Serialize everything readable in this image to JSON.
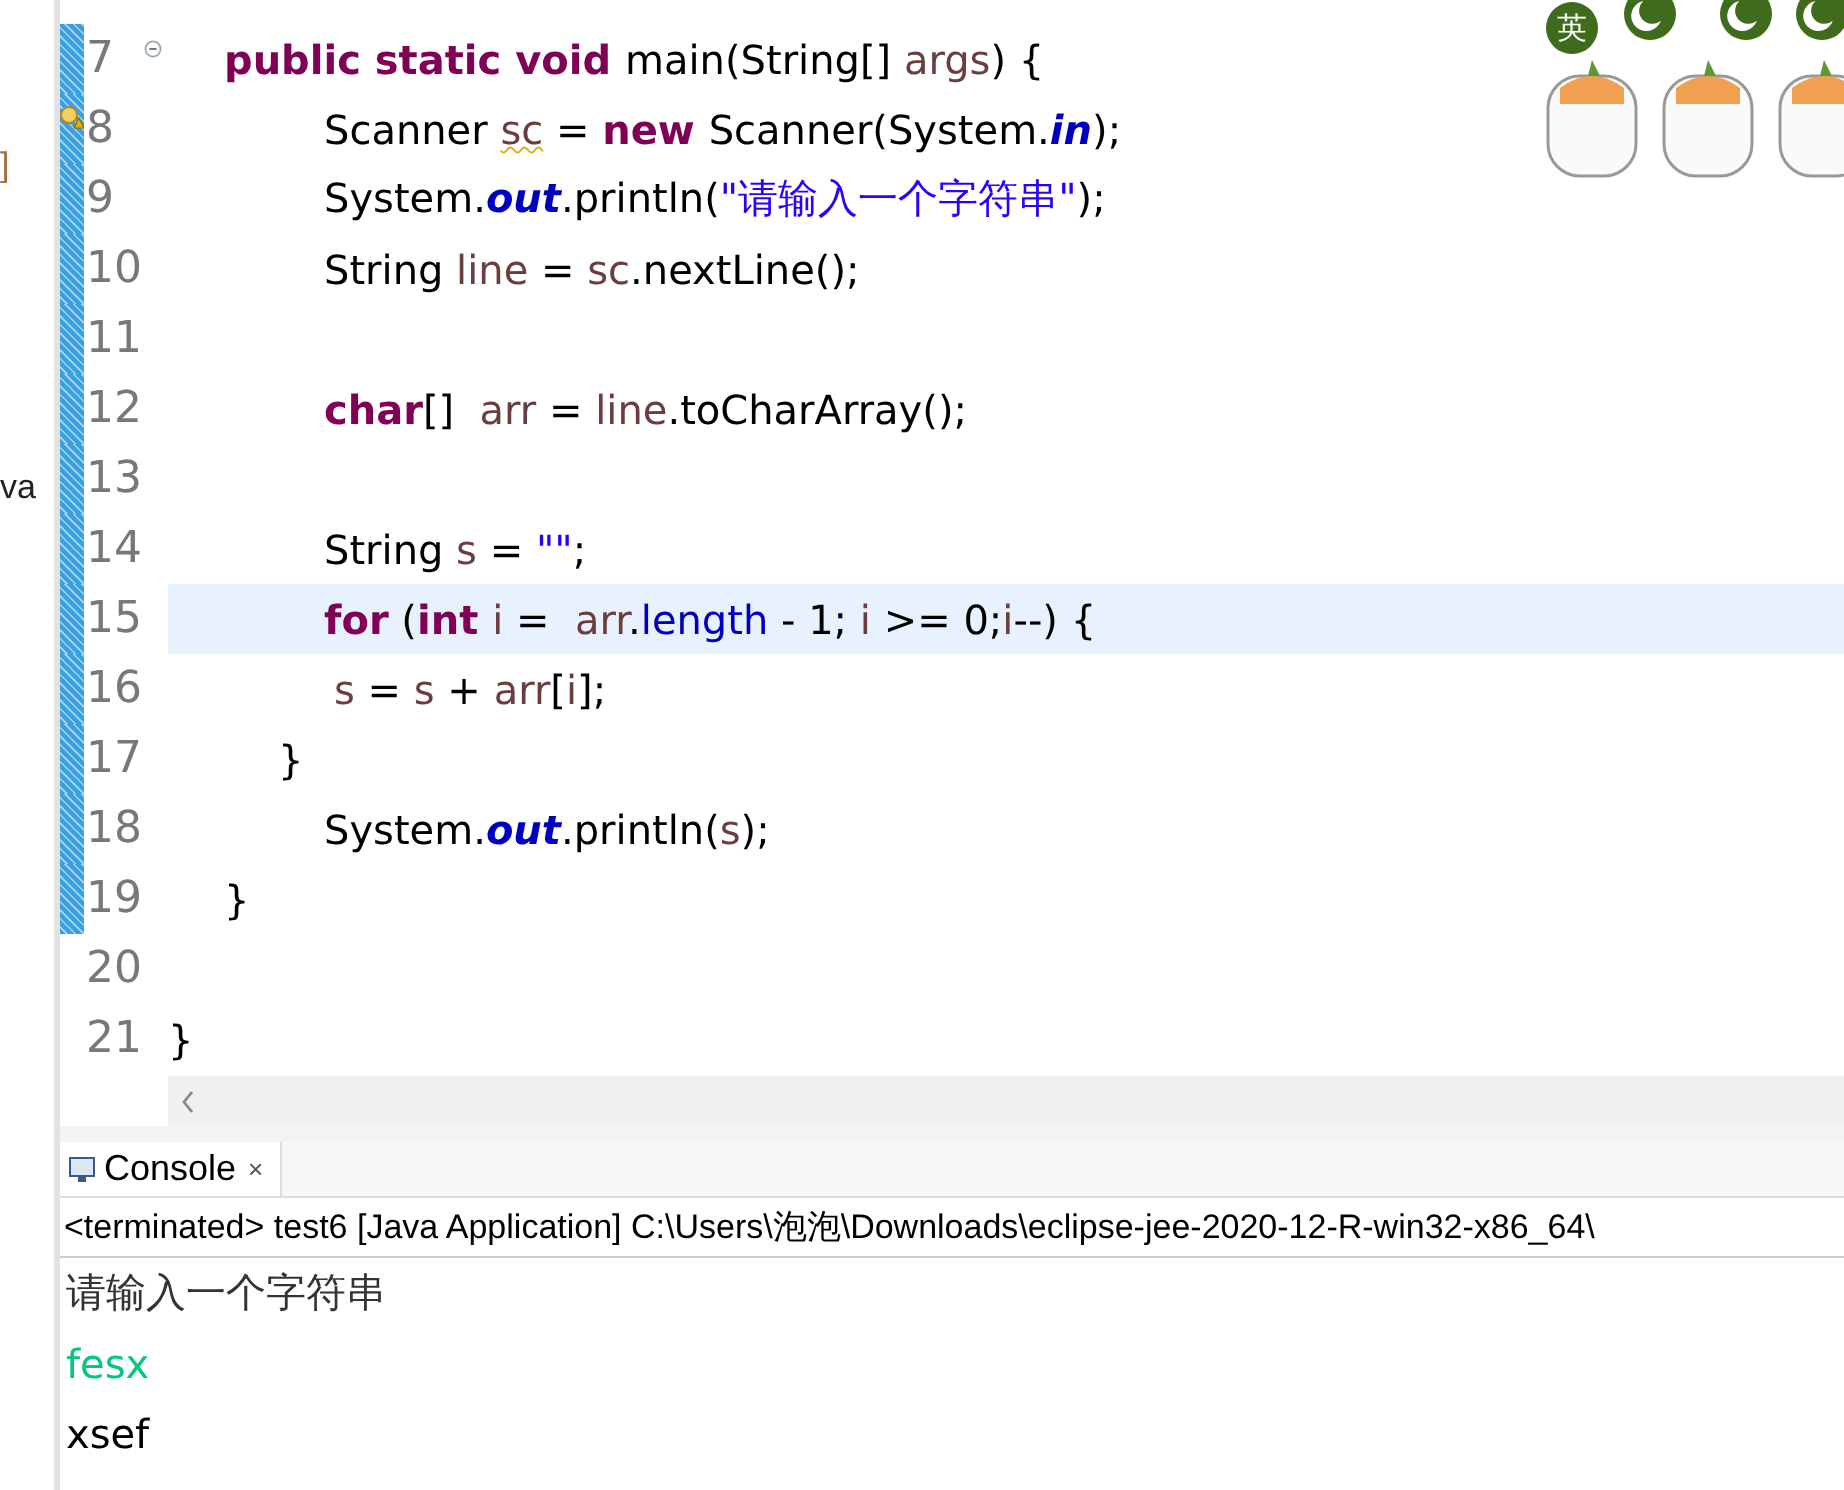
{
  "explorer_fragments": [
    {
      "text": "]",
      "kind": "bracket"
    },
    {
      "text": "va",
      "kind": "name"
    }
  ],
  "ime_toolbar": {
    "mode_label": "英"
  },
  "editor": {
    "lines": [
      {
        "number": "7",
        "kind": "method",
        "changed": true,
        "current": false,
        "warning": false,
        "foldable": true,
        "tokens": [
          {
            "text": "public static void ",
            "kind": "keyword"
          },
          {
            "text": "main(String[] ",
            "kind": "plain"
          },
          {
            "text": "args",
            "kind": "variable"
          },
          {
            "text": ") {",
            "kind": "plain"
          }
        ]
      },
      {
        "number": "8",
        "kind": "body",
        "changed": true,
        "current": false,
        "warning": true,
        "foldable": false,
        "tokens": [
          {
            "text": "Scanner ",
            "kind": "plain"
          },
          {
            "text": "sc",
            "kind": "warned_variable"
          },
          {
            "text": " = ",
            "kind": "plain"
          },
          {
            "text": "new ",
            "kind": "keyword"
          },
          {
            "text": "Scanner(System.",
            "kind": "plain"
          },
          {
            "text": "in",
            "kind": "static_field"
          },
          {
            "text": ");",
            "kind": "plain"
          }
        ]
      },
      {
        "number": "9",
        "kind": "body",
        "changed": true,
        "current": false,
        "warning": false,
        "foldable": false,
        "tokens": [
          {
            "text": "System.",
            "kind": "plain"
          },
          {
            "text": "out",
            "kind": "static_field"
          },
          {
            "text": ".println(",
            "kind": "plain"
          },
          {
            "text": "\"请输入一个字符串\"",
            "kind": "string"
          },
          {
            "text": ");",
            "kind": "plain"
          }
        ]
      },
      {
        "number": "10",
        "kind": "body",
        "changed": true,
        "current": false,
        "warning": false,
        "foldable": false,
        "tokens": [
          {
            "text": "String ",
            "kind": "plain"
          },
          {
            "text": "line",
            "kind": "variable"
          },
          {
            "text": " = ",
            "kind": "plain"
          },
          {
            "text": "sc",
            "kind": "variable"
          },
          {
            "text": ".nextLine();",
            "kind": "plain"
          }
        ]
      },
      {
        "number": "11",
        "changed": true,
        "current": false,
        "warning": false,
        "foldable": false
      },
      {
        "number": "12",
        "kind": "body",
        "changed": true,
        "current": false,
        "warning": false,
        "foldable": false,
        "tokens": [
          {
            "text": "char",
            "kind": "keyword"
          },
          {
            "text": "[]  ",
            "kind": "plain"
          },
          {
            "text": "arr",
            "kind": "variable"
          },
          {
            "text": " = ",
            "kind": "plain"
          },
          {
            "text": "line",
            "kind": "variable"
          },
          {
            "text": ".toCharArray();",
            "kind": "plain"
          }
        ]
      },
      {
        "number": "13",
        "changed": true,
        "current": false,
        "warning": false,
        "foldable": false
      },
      {
        "number": "14",
        "kind": "body",
        "changed": true,
        "current": false,
        "warning": false,
        "foldable": false,
        "tokens": [
          {
            "text": "String ",
            "kind": "plain"
          },
          {
            "text": "s",
            "kind": "variable"
          },
          {
            "text": " = ",
            "kind": "plain"
          },
          {
            "text": "\"\"",
            "kind": "string"
          },
          {
            "text": ";",
            "kind": "plain"
          }
        ]
      },
      {
        "number": "15",
        "kind": "body",
        "changed": true,
        "current": true,
        "warning": false,
        "foldable": false,
        "tokens": [
          {
            "text": "for",
            "kind": "keyword"
          },
          {
            "text": " (",
            "kind": "plain"
          },
          {
            "text": "int ",
            "kind": "keyword"
          },
          {
            "text": "i",
            "kind": "variable"
          },
          {
            "text": " =  ",
            "kind": "plain"
          },
          {
            "text": "arr",
            "kind": "variable"
          },
          {
            "text": ".",
            "kind": "plain"
          },
          {
            "text": "length",
            "kind": "field"
          },
          {
            "text": " - 1; ",
            "kind": "plain"
          },
          {
            "text": "i",
            "kind": "variable"
          },
          {
            "text": " >= 0;",
            "kind": "plain"
          },
          {
            "text": "i",
            "kind": "variable"
          },
          {
            "text": "--) {",
            "kind": "plain"
          }
        ]
      },
      {
        "number": "16",
        "kind": "loop_body",
        "changed": true,
        "current": false,
        "warning": false,
        "foldable": false,
        "tokens": [
          {
            "text": "s",
            "kind": "variable"
          },
          {
            "text": " = ",
            "kind": "plain"
          },
          {
            "text": "s",
            "kind": "variable"
          },
          {
            "text": " + ",
            "kind": "plain"
          },
          {
            "text": "arr",
            "kind": "variable"
          },
          {
            "text": "[",
            "kind": "plain"
          },
          {
            "text": "i",
            "kind": "variable"
          },
          {
            "text": "];",
            "kind": "plain"
          }
        ]
      },
      {
        "number": "17",
        "kind": "loop_close",
        "changed": true,
        "current": false,
        "warning": false,
        "foldable": false,
        "tokens": [
          {
            "text": "}",
            "kind": "plain"
          }
        ]
      },
      {
        "number": "18",
        "kind": "body",
        "changed": true,
        "current": false,
        "warning": false,
        "foldable": false,
        "tokens": [
          {
            "text": "System.",
            "kind": "plain"
          },
          {
            "text": "out",
            "kind": "static_field"
          },
          {
            "text": ".println(",
            "kind": "plain"
          },
          {
            "text": "s",
            "kind": "variable"
          },
          {
            "text": ");",
            "kind": "plain"
          }
        ]
      },
      {
        "number": "19",
        "kind": "method",
        "changed": true,
        "current": false,
        "warning": false,
        "foldable": false,
        "tokens": [
          {
            "text": "}",
            "kind": "plain"
          }
        ]
      },
      {
        "number": "20",
        "changed": false,
        "current": false,
        "warning": false,
        "foldable": false
      },
      {
        "number": "21",
        "kind": "class",
        "changed": false,
        "current": false,
        "warning": false,
        "foldable": false,
        "tokens": [
          {
            "text": "}",
            "kind": "plain"
          }
        ]
      }
    ]
  },
  "console": {
    "tab": {
      "label": "Console",
      "close": "×"
    },
    "status": "<terminated> test6 [Java Application] C:\\Users\\泡泡\\Downloads\\eclipse-jee-2020-12-R-win32-x86_64\\",
    "output": [
      {
        "text": "请输入一个字符串",
        "kind": "output"
      },
      {
        "text": "fesx",
        "kind": "input"
      },
      {
        "text": "xsef",
        "kind": "output_plain"
      }
    ]
  }
}
